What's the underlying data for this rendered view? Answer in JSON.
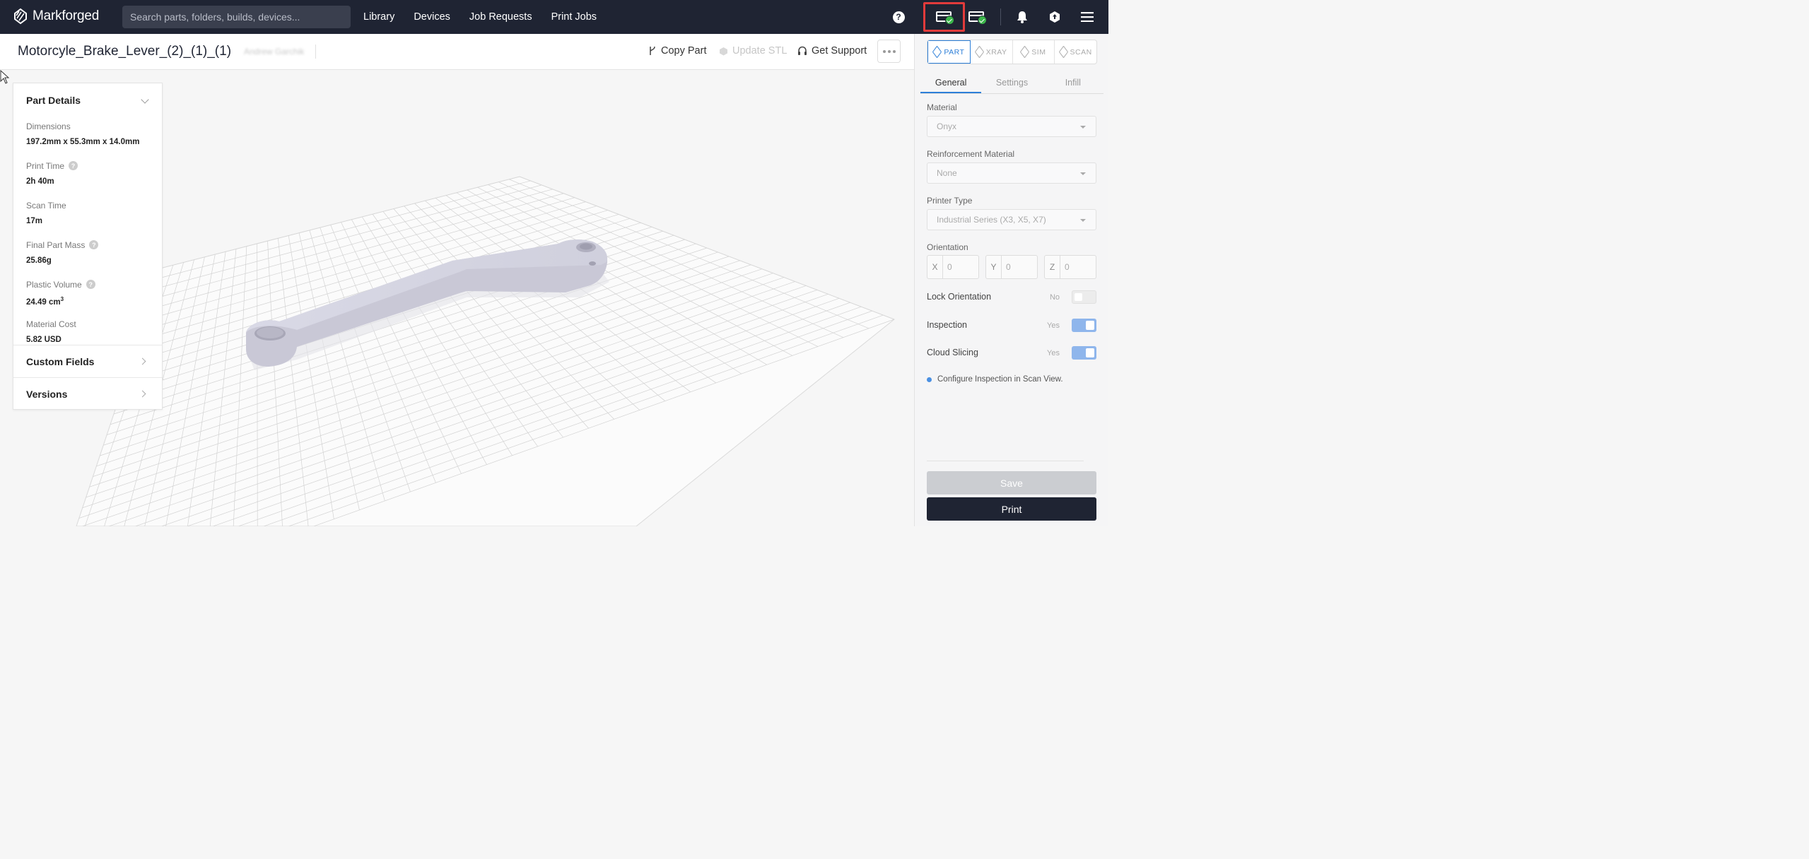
{
  "nav": {
    "brand": "Markforged",
    "search_placeholder": "Search parts, folders, builds, devices...",
    "links": [
      "Library",
      "Devices",
      "Job Requests",
      "Print Jobs"
    ],
    "help": "?"
  },
  "header": {
    "title": "Motorcyle_Brake_Lever_(2)_(1)_(1)",
    "owner": "Andrew Garchik",
    "copy_part": "Copy Part",
    "update_stl": "Update STL",
    "get_support": "Get Support"
  },
  "details": {
    "heading": "Part Details",
    "items": [
      {
        "label": "Dimensions",
        "value": "197.2mm x 55.3mm x 14.0mm"
      },
      {
        "label": "Print Time",
        "value": "2h 40m"
      },
      {
        "label": "Scan Time",
        "value": "17m"
      },
      {
        "label": "Final Part Mass",
        "value": "25.86g"
      },
      {
        "label": "Plastic Volume",
        "value": "24.49 cm",
        "sup": "3"
      },
      {
        "label": "Material Cost",
        "value": "5.82 USD"
      }
    ],
    "custom_fields": "Custom Fields",
    "versions": "Versions"
  },
  "panel": {
    "modes": [
      "PART",
      "XRAY",
      "SIM",
      "SCAN"
    ],
    "tabs": [
      "General",
      "Settings",
      "Infill"
    ],
    "material_label": "Material",
    "material_value": "Onyx",
    "reinforcement_label": "Reinforcement Material",
    "reinforcement_value": "None",
    "printer_label": "Printer Type",
    "printer_value": "Industrial Series (X3, X5, X7)",
    "orientation_label": "Orientation",
    "orientation": {
      "x": "0",
      "y": "0",
      "z": "0"
    },
    "axes": {
      "x": "X",
      "y": "Y",
      "z": "Z"
    },
    "lock_label": "Lock Orientation",
    "lock_state": "No",
    "inspection_label": "Inspection",
    "inspection_state": "Yes",
    "cloud_label": "Cloud Slicing",
    "cloud_state": "Yes",
    "info_text": "Configure Inspection in Scan View.",
    "save": "Save",
    "print": "Print"
  },
  "icons": {
    "accent": "#2d7fd8",
    "nav_bg": "#1f2433",
    "status_ok": "#3bb54a",
    "highlight": "#e23b3b"
  }
}
